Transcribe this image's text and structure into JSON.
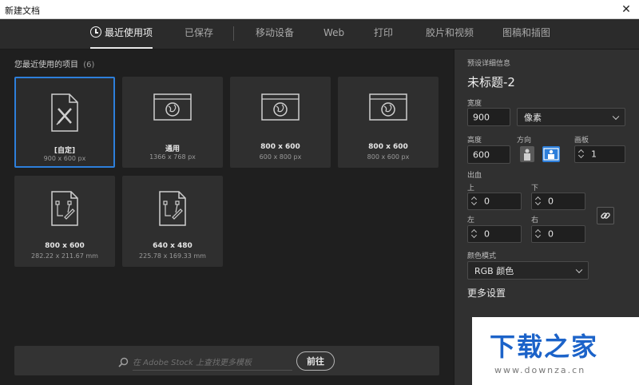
{
  "window": {
    "title": "新建文档",
    "close_glyph": "✕"
  },
  "tabs": [
    {
      "label": "最近使用项",
      "icon": "clock-icon",
      "active": true
    },
    {
      "label": "已保存"
    },
    {
      "label": "移动设备"
    },
    {
      "label": "Web"
    },
    {
      "label": "打印"
    },
    {
      "label": "胶片和视频"
    },
    {
      "label": "图稿和插图"
    }
  ],
  "recent": {
    "title": "您最近使用的项目",
    "count": "(6)",
    "items": [
      {
        "name": "[自定]",
        "dims": "900 x 600 px",
        "icon": "custom-doc-icon",
        "selected": true
      },
      {
        "name": "通用",
        "dims": "1366 x 768 px",
        "icon": "web-globe-icon"
      },
      {
        "name": "800 x 600",
        "dims": "600 x 800 px",
        "icon": "web-globe-icon"
      },
      {
        "name": "800 x 600",
        "dims": "800 x 600 px",
        "icon": "web-globe-icon"
      },
      {
        "name": "800 x 600",
        "dims": "282.22 x 211.67 mm",
        "icon": "print-doc-icon"
      },
      {
        "name": "640 x 480",
        "dims": "225.78 x 169.33 mm",
        "icon": "print-doc-icon"
      }
    ]
  },
  "stock": {
    "placeholder": "在 Adobe Stock 上查找更多模板",
    "go_label": "前往",
    "icon": "search-icon"
  },
  "preset": {
    "header": "预设详细信息",
    "name": "未标题-2",
    "width_label": "宽度",
    "width_value": "900",
    "unit_value": "像素",
    "height_label": "高度",
    "height_value": "600",
    "orientation_label": "方向",
    "artboard_label": "画板",
    "artboard_value": "1",
    "bleed_label": "出血",
    "top_label": "上",
    "top_value": "0",
    "bottom_label": "下",
    "bottom_value": "0",
    "left_label": "左",
    "left_value": "0",
    "right_label": "右",
    "right_value": "0",
    "color_mode_label": "颜色模式",
    "color_mode_value": "RGB 颜色",
    "more_settings": "更多设置"
  },
  "watermark": {
    "text": "下载之家",
    "url": "www.downza.cn"
  },
  "colors": {
    "accent": "#2d7fdb",
    "orient_active": "#2d7fdb",
    "bg": "#1f1f1f",
    "panel": "#303030"
  }
}
